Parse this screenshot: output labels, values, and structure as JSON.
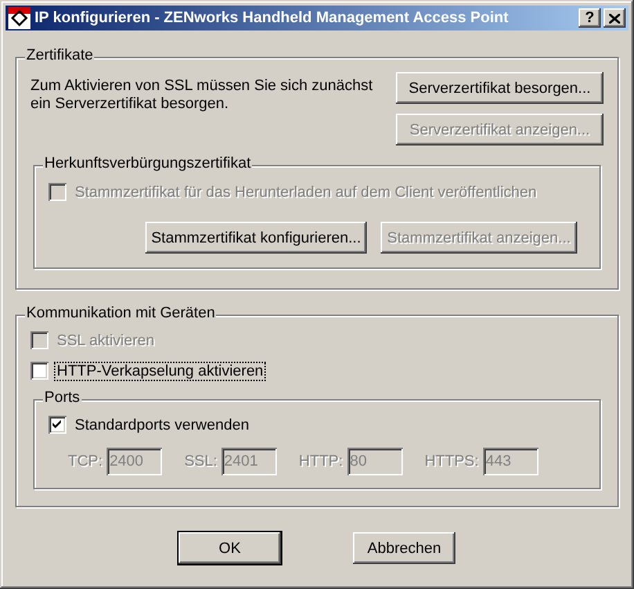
{
  "window": {
    "title": "IP konfigurieren - ZENworks Handheld Management Access Point",
    "help_button": "?"
  },
  "certificates": {
    "title": "Zertifikate",
    "text": "Zum Aktivieren von SSL müssen Sie sich zunächst ein Serverzertifikat besorgen.",
    "buttons": [
      {
        "label": "Serverzertifikat besorgen...",
        "disabled": false
      },
      {
        "label": "Serverzertifikat anzeigen...",
        "disabled": true
      }
    ],
    "origin": {
      "title": "Herkunftsverbürgungszertifikat",
      "checkbox": {
        "label": "Stammzertifikat für das Herunterladen auf dem Client veröffentlichen",
        "checked": false,
        "disabled": true
      },
      "buttons": [
        {
          "label": "Stammzertifikat konfigurieren...",
          "disabled": false
        },
        {
          "label": "Stammzertifikat anzeigen...",
          "disabled": true
        }
      ]
    }
  },
  "communication": {
    "title": "Kommunikation mit Geräten",
    "options": [
      {
        "label": "SSL aktivieren",
        "checked": false,
        "disabled": true,
        "focused": false
      },
      {
        "label": "HTTP-Verkapselung aktivieren",
        "checked": false,
        "disabled": false,
        "focused": true
      }
    ],
    "ports": {
      "title": "Ports",
      "checkbox": {
        "label": "Standardports verwenden",
        "checked": true,
        "disabled": false
      },
      "fields": [
        {
          "label": "TCP:",
          "value": "2400",
          "disabled": true
        },
        {
          "label": "SSL:",
          "value": "2401",
          "disabled": true
        },
        {
          "label": "HTTP:",
          "value": "80",
          "disabled": true
        },
        {
          "label": "HTTPS:",
          "value": "443",
          "disabled": true
        }
      ]
    }
  },
  "buttons": [
    {
      "label": "OK",
      "default": true
    },
    {
      "label": "Abbrechen",
      "default": false
    }
  ]
}
